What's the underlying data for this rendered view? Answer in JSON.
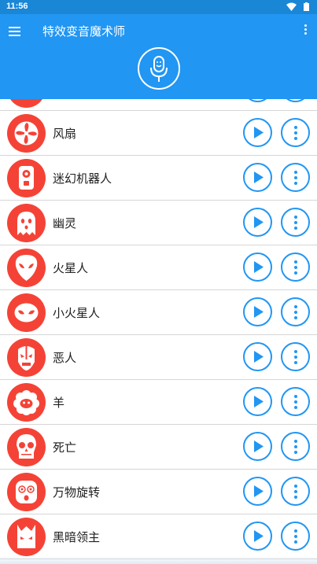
{
  "status_bar": {
    "time": "11:56"
  },
  "app_bar": {
    "title": "特效变音魔术师"
  },
  "theme": {
    "primary": "#2196f3",
    "avatar_bg": "#f44336"
  },
  "effects": [
    {
      "label": "",
      "icon": "partial-icon"
    },
    {
      "label": "风扇",
      "icon": "fan-icon"
    },
    {
      "label": "迷幻机器人",
      "icon": "robot-icon"
    },
    {
      "label": "幽灵",
      "icon": "ghost-icon"
    },
    {
      "label": "火星人",
      "icon": "alien-icon"
    },
    {
      "label": "小火星人",
      "icon": "small-alien-icon"
    },
    {
      "label": "恶人",
      "icon": "villain-icon"
    },
    {
      "label": "羊",
      "icon": "sheep-icon"
    },
    {
      "label": "死亡",
      "icon": "skull-icon"
    },
    {
      "label": "万物旋转",
      "icon": "spiral-face-icon"
    },
    {
      "label": "黑暗领主",
      "icon": "dark-lord-icon"
    }
  ]
}
